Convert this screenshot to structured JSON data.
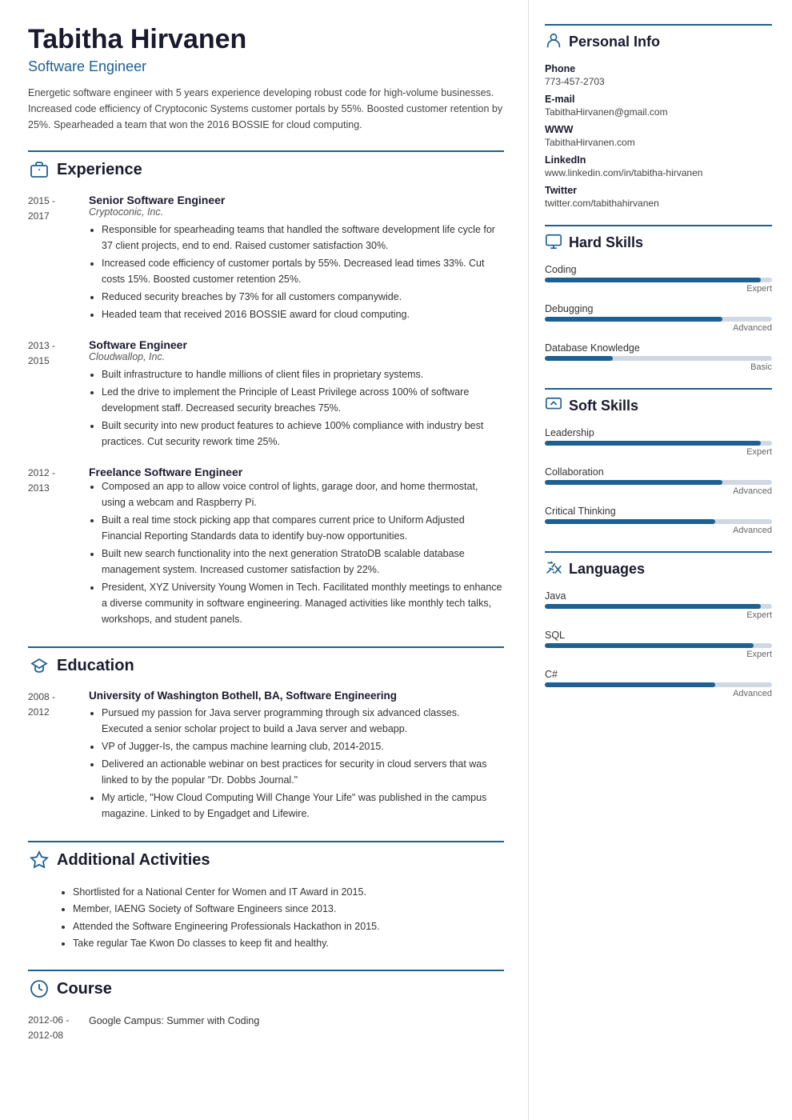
{
  "header": {
    "name": "Tabitha Hirvanen",
    "title": "Software Engineer",
    "summary": "Energetic software engineer with 5 years experience developing robust code for high-volume businesses. Increased code efficiency of Cryptoconic Systems customer portals by 55%. Boosted customer retention by 25%. Spearheaded a team that won the 2016 BOSSIE for cloud computing."
  },
  "sections": {
    "experience_title": "Experience",
    "education_title": "Education",
    "activities_title": "Additional Activities",
    "course_title": "Course",
    "personal_title": "Personal Info",
    "hard_skills_title": "Hard Skills",
    "soft_skills_title": "Soft Skills",
    "languages_title": "Languages"
  },
  "experience": [
    {
      "dates": "2015 -\n2017",
      "job_title": "Senior Software Engineer",
      "company": "Cryptoconic, Inc.",
      "bullets": [
        "Responsible for spearheading teams that handled the software development life cycle for 37 client projects, end to end. Raised customer satisfaction 30%.",
        "Increased code efficiency of customer portals by 55%. Decreased lead times 33%. Cut costs 15%. Boosted customer retention 25%.",
        "Reduced security breaches by 73% for all customers companywide.",
        "Headed team that received 2016 BOSSIE award for cloud computing."
      ]
    },
    {
      "dates": "2013 -\n2015",
      "job_title": "Software Engineer",
      "company": "Cloudwallop, Inc.",
      "bullets": [
        "Built infrastructure to handle millions of client files in proprietary systems.",
        "Led the drive to implement the Principle of Least Privilege across 100% of software development staff. Decreased security breaches 75%.",
        "Built security into new product features to achieve 100% compliance with industry best practices. Cut security rework time 25%."
      ]
    },
    {
      "dates": "2012 -\n2013",
      "job_title": "Freelance Software Engineer",
      "company": "",
      "bullets": [
        "Composed an app to allow voice control of lights, garage door, and home thermostat, using a webcam and Raspberry Pi.",
        "Built a real time stock picking app that compares current price to Uniform Adjusted Financial Reporting Standards data to identify buy-now opportunities.",
        "Built new search functionality into the next generation StratoDB scalable database management system. Increased customer satisfaction by 22%.",
        "President, XYZ University Young Women in Tech. Facilitated monthly meetings to enhance a diverse community in software engineering. Managed activities like monthly tech talks, workshops, and student panels."
      ]
    }
  ],
  "education": [
    {
      "dates": "2008 -\n2012",
      "school": "University of Washington Bothell, BA, Software Engineering",
      "bullets": [
        "Pursued my passion for Java server programming through six advanced classes. Executed a senior scholar project to build a Java server and webapp.",
        "VP of Jugger-Is, the campus machine learning club, 2014-2015.",
        "Delivered an actionable webinar on best practices for security in cloud servers that was linked to by the popular \"Dr. Dobbs Journal.\"",
        "My article, \"How Cloud Computing Will Change Your Life\" was published in the campus magazine. Linked to by Engadget and Lifewire."
      ]
    }
  ],
  "activities": [
    "Shortlisted for a National Center for Women and IT Award in 2015.",
    "Member, IAENG Society of Software Engineers since 2013.",
    "Attended the Software Engineering Professionals Hackathon in 2015.",
    "Take regular Tae Kwon Do classes to keep fit and healthy."
  ],
  "courses": [
    {
      "dates": "2012-06 -\n2012-08",
      "name": "Google Campus: Summer with Coding"
    }
  ],
  "personal_info": {
    "phone_label": "Phone",
    "phone": "773-457-2703",
    "email_label": "E-mail",
    "email": "TabithaHirvanen@gmail.com",
    "www_label": "WWW",
    "www": "TabithaHirvanen.com",
    "linkedin_label": "LinkedIn",
    "linkedin": "www.linkedin.com/in/tabitha-hirvanen",
    "twitter_label": "Twitter",
    "twitter": "twitter.com/tabithahirvanen"
  },
  "hard_skills": [
    {
      "name": "Coding",
      "level": "Expert",
      "pct": 95
    },
    {
      "name": "Debugging",
      "level": "Advanced",
      "pct": 78
    },
    {
      "name": "Database Knowledge",
      "level": "Basic",
      "pct": 30
    }
  ],
  "soft_skills": [
    {
      "name": "Leadership",
      "level": "Expert",
      "pct": 95
    },
    {
      "name": "Collaboration",
      "level": "Advanced",
      "pct": 78
    },
    {
      "name": "Critical Thinking",
      "level": "Advanced",
      "pct": 75
    }
  ],
  "languages": [
    {
      "name": "Java",
      "level": "Expert",
      "pct": 95
    },
    {
      "name": "SQL",
      "level": "Expert",
      "pct": 92
    },
    {
      "name": "C#",
      "level": "Advanced",
      "pct": 75
    }
  ]
}
